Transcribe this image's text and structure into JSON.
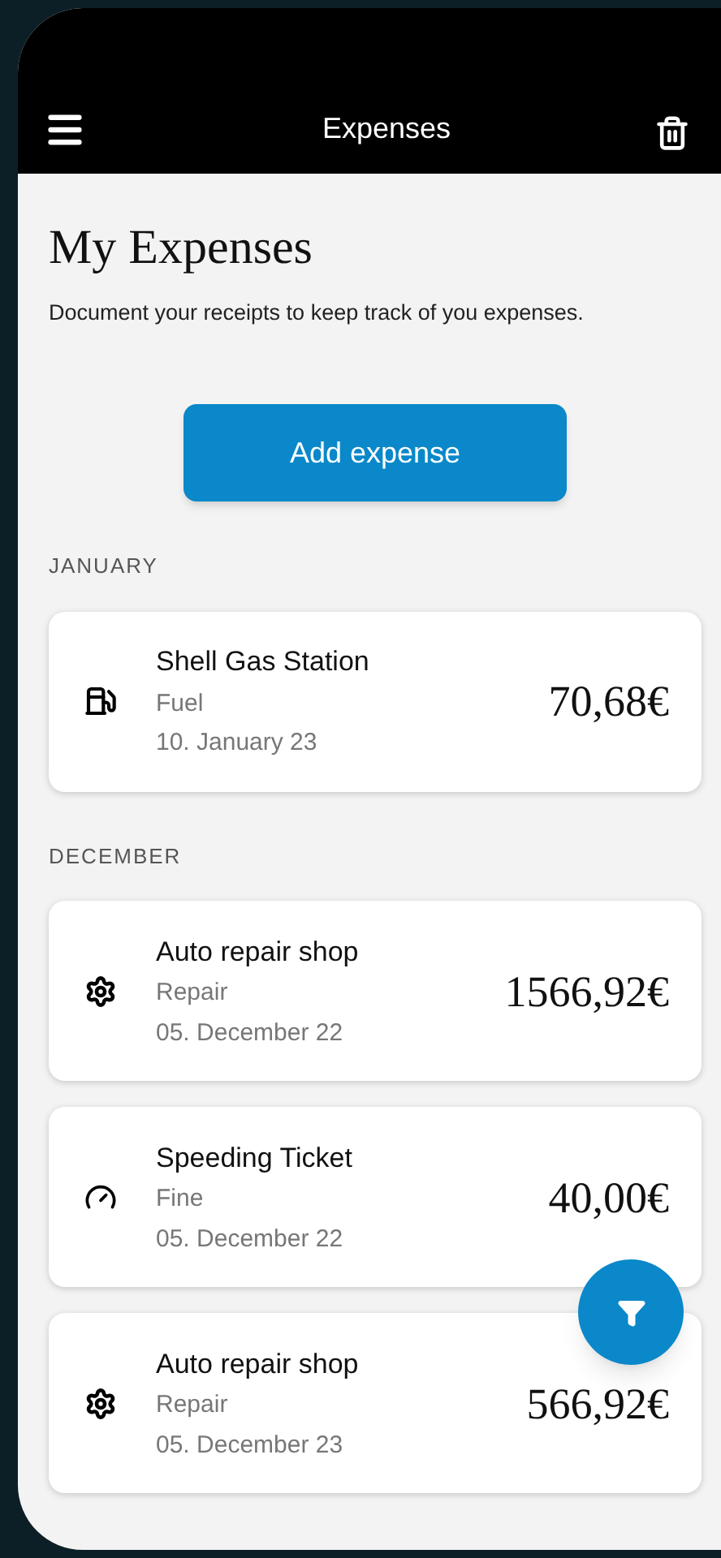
{
  "header": {
    "title": "Expenses"
  },
  "page": {
    "title": "My Expenses",
    "description": "Document your receipts to keep track of you expenses."
  },
  "add_button": {
    "label": "Add expense"
  },
  "sections": [
    {
      "heading": "JANUARY",
      "expenses": [
        {
          "kind": "fuel",
          "name": "Shell Gas Station",
          "category": "Fuel",
          "date": "10. January 23",
          "amount": "70,68€"
        }
      ]
    },
    {
      "heading": "DECEMBER",
      "expenses": [
        {
          "kind": "repair",
          "name": "Auto repair shop",
          "category": "Repair",
          "date": "05. December 22",
          "amount": "1566,92€"
        },
        {
          "kind": "fine",
          "name": "Speeding Ticket",
          "category": "Fine",
          "date": "05. December 22",
          "amount": "40,00€"
        },
        {
          "kind": "repair",
          "name": "Auto repair shop",
          "category": "Repair",
          "date": "05. December 23",
          "amount": "566,92€"
        }
      ]
    }
  ]
}
